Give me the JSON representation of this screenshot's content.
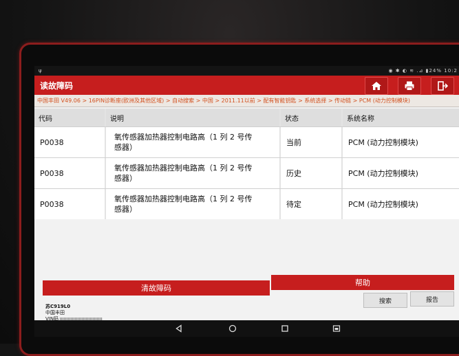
{
  "statusbar": {
    "left_icon": "ψ",
    "right_text": "◉ ✱ ◐ ≋ .⊿ ▮24% 10:2"
  },
  "header": {
    "title": "读故障码"
  },
  "toolbar": {
    "home_icon": "home-icon",
    "print_icon": "printer-icon",
    "exit_icon": "exit-icon"
  },
  "breadcrumb": "中国丰田 V49.06 > 16PIN诊断座(欧洲及其他区域) > 自动搜索 > 中国 > 2011.11以前 > 配有智能钥匙 > 系统选择 > 传动链 > PCM (动力控制模块)",
  "table": {
    "headers": [
      "代码",
      "说明",
      "状态",
      "系统名称"
    ],
    "rows": [
      {
        "code": "P0038",
        "desc_line1": "氧传感器加热器控制电路高（1 列 2 号传",
        "desc_line2": "感器）",
        "status": "当前",
        "system": "PCM (动力控制模块)"
      },
      {
        "code": "P0038",
        "desc_line1": "氧传感器加热器控制电路高（1 列 2 号传",
        "desc_line2": "感器）",
        "status": "历史",
        "system": "PCM (动力控制模块)"
      },
      {
        "code": "P0038",
        "desc_line1": "氧传感器加热器控制电路高（1 列 2 号传",
        "desc_line2": "感器）",
        "status": "待定",
        "system": "PCM (动力控制模块)"
      }
    ]
  },
  "buttons": {
    "clear": "清故障码",
    "help": "帮助",
    "search": "搜索",
    "report": "报告"
  },
  "vehicle": {
    "plate": "苏C919L0",
    "make": "中国丰田",
    "vin_label": "VIN码"
  },
  "colors": {
    "accent": "#c61e1e",
    "breadcrumb_text": "#d2501f",
    "bezel": "#8c1d1d"
  }
}
